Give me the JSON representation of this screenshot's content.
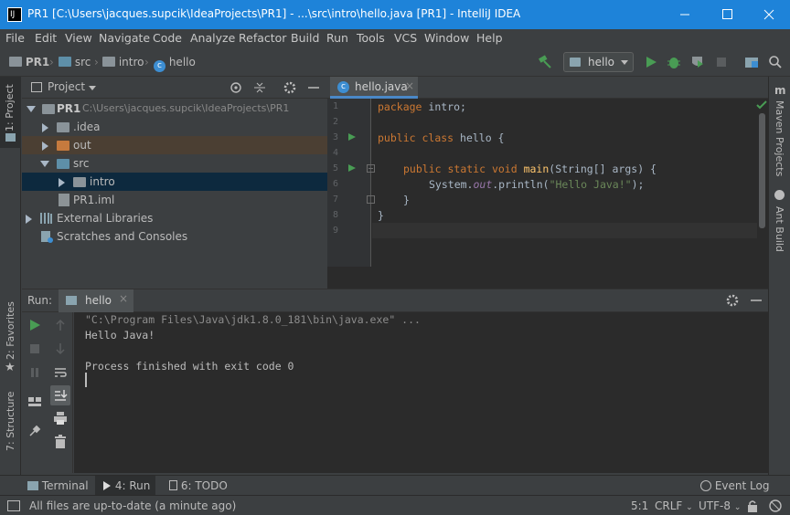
{
  "window": {
    "title": "PR1 [C:\\Users\\jacques.supcik\\IdeaProjects\\PR1] - ...\\src\\intro\\hello.java [PR1] - IntelliJ IDEA",
    "app_icon_text": "IJ"
  },
  "menu": [
    "File",
    "Edit",
    "View",
    "Navigate",
    "Code",
    "Analyze",
    "Refactor",
    "Build",
    "Run",
    "Tools",
    "VCS",
    "Window",
    "Help"
  ],
  "breadcrumb": [
    "PR1",
    "src",
    "intro",
    "hello"
  ],
  "run_config": "hello",
  "project_panel": {
    "title": "Project",
    "tree": [
      {
        "label": "PR1",
        "path": "C:\\Users\\jacques.supcik\\IdeaProjects\\PR1"
      },
      {
        "label": ".idea"
      },
      {
        "label": "out"
      },
      {
        "label": "src"
      },
      {
        "label": "intro"
      },
      {
        "label": "PR1.iml"
      },
      {
        "label": "External Libraries"
      },
      {
        "label": "Scratches and Consoles"
      }
    ]
  },
  "editor": {
    "tab": "hello.java",
    "line_numbers": [
      "1",
      "2",
      "3",
      "4",
      "5",
      "6",
      "7",
      "8",
      "9"
    ],
    "lines": {
      "l1_kw": "package",
      "l1_rest": " intro;",
      "l3_kw1": "public",
      "l3_kw2": " class",
      "l3_rest": " hello {",
      "l5_kw1": "public",
      "l5_kw2": " static",
      "l5_kw3": " void",
      "l5_mth": " main",
      "l5_rest": "(String[] args) {",
      "l6_a": "System.",
      "l6_fld": "out",
      "l6_b": ".println(",
      "l6_str": "\"Hello Java!\"",
      "l6_c": ");",
      "l7": "}",
      "l8": "}"
    }
  },
  "run_panel": {
    "label": "Run:",
    "tab": "hello",
    "console": [
      "\"C:\\Program Files\\Java\\jdk1.8.0_181\\bin\\java.exe\" ...",
      "Hello Java!",
      "",
      "Process finished with exit code 0"
    ]
  },
  "side_tabs": {
    "left_top": "1: Project",
    "left_fav": "2: Favorites",
    "left_struct": "7: Structure",
    "right_maven": "Maven Projects",
    "right_ant": "Ant Build"
  },
  "bottom_tabs": {
    "terminal": "Terminal",
    "run": "4: Run",
    "todo": "6: TODO",
    "event_log": "Event Log"
  },
  "status": {
    "message": "All files are up-to-date (a minute ago)",
    "position": "5:1",
    "line_sep": "CRLF",
    "encoding": "UTF-8"
  },
  "colors": {
    "titlebar": "#1e83d9",
    "background": "#3c3f41",
    "editor_bg": "#2b2b2b",
    "keyword": "#cc7832",
    "string": "#6a8759",
    "run_green": "#499c54"
  }
}
